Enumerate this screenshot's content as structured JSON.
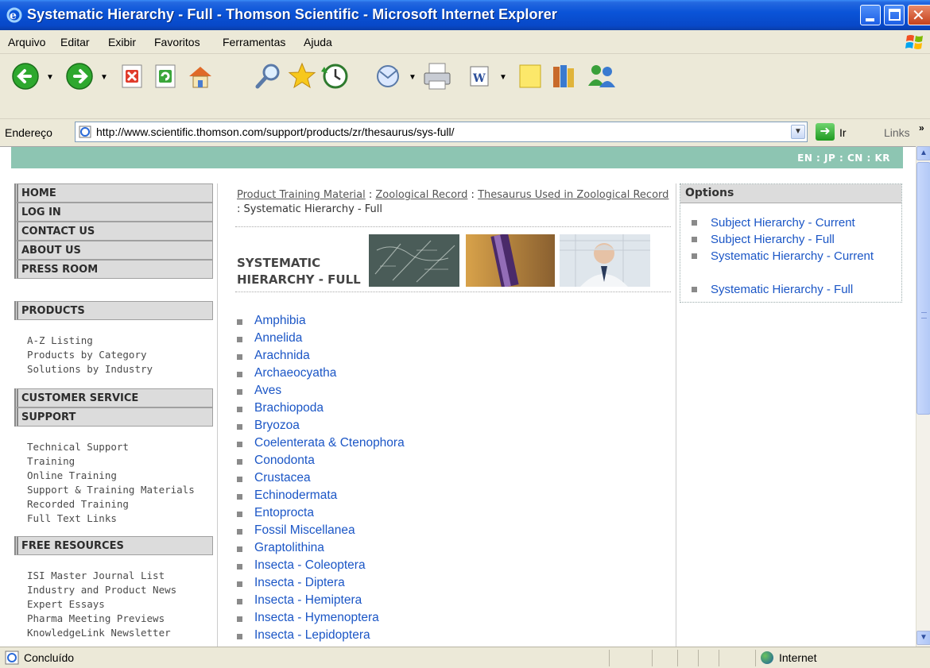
{
  "window": {
    "title": "Systematic Hierarchy - Full - Thomson Scientific - Microsoft Internet Explorer"
  },
  "menu": [
    "Arquivo",
    "Editar",
    "Exibir",
    "Favoritos",
    "Ferramentas",
    "Ajuda"
  ],
  "toolbar": {
    "icons": [
      "back-icon",
      "forward-icon",
      "stop-icon",
      "refresh-icon",
      "home-icon",
      "search-icon",
      "favorites-icon",
      "history-icon",
      "mail-icon",
      "print-icon",
      "edit-icon",
      "discuss-icon",
      "research-icon",
      "messenger-icon"
    ]
  },
  "address": {
    "label": "Endereço",
    "url": "http://www.scientific.thomson.com/support/products/zr/thesaurus/sys-full/",
    "go_label": "Ir",
    "links_label": "Links"
  },
  "page": {
    "languages": "EN : JP : CN : KR",
    "nav_top": [
      "HOME",
      "LOG IN",
      "CONTACT US",
      "ABOUT US",
      "PRESS ROOM"
    ],
    "products_header": "PRODUCTS",
    "products_links": [
      "A-Z Listing",
      "Products by Category",
      "Solutions by Industry"
    ],
    "customer_service_header": "CUSTOMER SERVICE",
    "support_header": "SUPPORT",
    "support_links": [
      "Technical Support",
      "Training",
      "Online Training",
      "Support & Training Materials",
      "Recorded Training",
      "Full Text Links"
    ],
    "free_resources_header": "FREE RESOURCES",
    "free_resources_links": [
      "ISI Master Journal List",
      "Industry and Product News",
      "Expert Essays",
      "Pharma Meeting Previews",
      "KnowledgeLink Newsletter"
    ],
    "breadcrumb": {
      "links": [
        "Product Training Material",
        "Zoological Record",
        "Thesaurus Used in Zoological Record"
      ],
      "current": "Systematic Hierarchy - Full",
      "separator": " : "
    },
    "title_line1": "SYSTEMATIC",
    "title_line2": "HIERARCHY - FULL",
    "taxa": [
      "Amphibia",
      "Annelida",
      "Arachnida",
      "Archaeocyatha",
      "Aves",
      "Brachiopoda",
      "Bryozoa",
      "Coelenterata & Ctenophora",
      "Conodonta",
      "Crustacea",
      "Echinodermata",
      "Entoprocta",
      "Fossil Miscellanea",
      "Graptolithina",
      "Insecta - Coleoptera",
      "Insecta - Diptera",
      "Insecta - Hemiptera",
      "Insecta - Hymenoptera",
      "Insecta - Lepidoptera"
    ],
    "options_header": "Options",
    "options": [
      "Subject Hierarchy - Current",
      "Subject Hierarchy - Full",
      "Systematic Hierarchy - Current",
      "Systematic Hierarchy - Full"
    ]
  },
  "status": {
    "text": "Concluído",
    "zone": "Internet"
  },
  "colors": {
    "link": "#1b56c6",
    "lang_strip": "#8dc5b2",
    "titlebar": "#0a54d8"
  }
}
